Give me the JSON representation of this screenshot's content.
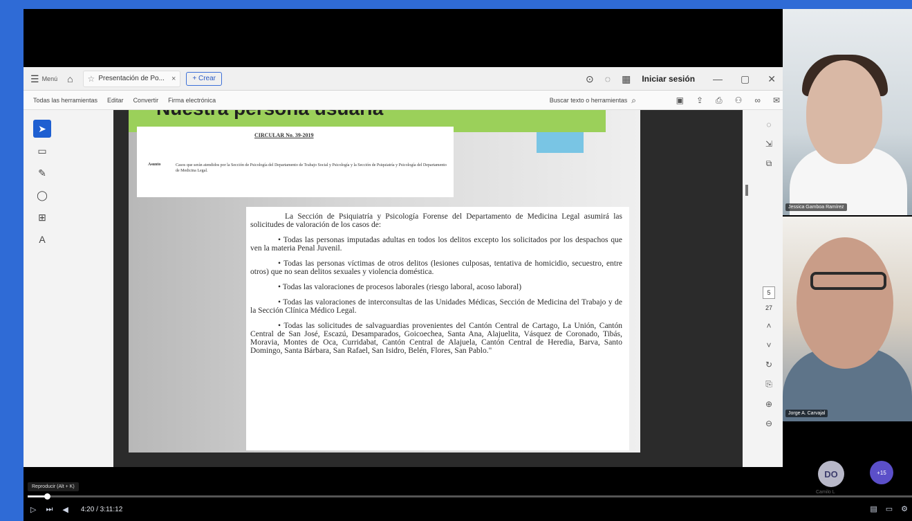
{
  "browser": {
    "menu_label": "Menú",
    "tab_title": "Presentación de Po...",
    "new_tab_label": "+ Crear",
    "signin_label": "Iniciar sesión"
  },
  "toolbar": {
    "tabs": [
      "Todas las herramientas",
      "Editar",
      "Convertir",
      "Firma electrónica"
    ],
    "search_label": "Buscar texto o herramientas"
  },
  "slide": {
    "title": "Nuestra persona usuaria",
    "circular_title": "CIRCULAR No. 39-2019",
    "asunto_label": "Asunto",
    "asunto_text": "Casos que serán atendidos por la Sección de Psicología del Departamento de Trabajo Social y Psicología y la Sección de Psiquiatría y Psicología del Departamento de Medicina Legal.",
    "paragraphs": [
      "La Sección de Psiquiatría y Psicología Forense del Departamento de Medicina Legal asumirá las solicitudes de valoración de los casos de:",
      "•        Todas las personas imputadas adultas en todos los delitos excepto los solicitados por los despachos que ven la materia Penal Juvenil.",
      "•        Todas las personas víctimas de otros delitos (lesiones culposas, tentativa de homicidio, secuestro, entre otros) que no sean delitos sexuales y violencia doméstica.",
      "•        Todas las valoraciones de procesos laborales (riesgo laboral, acoso laboral)",
      "•        Todas las valoraciones de interconsultas de las Unidades Médicas, Sección de Medicina del Trabajo y de la Sección Clínica Médico Legal.",
      "•        Todas las solicitudes de salvaguardias provenientes del Cantón Central de Cartago, La Unión, Cantón Central de San José, Escazú, Desamparados, Goicoechea, Santa Ana, Alajuelita, Vásquez de Coronado, Tibás, Moravia, Montes de Oca, Curridabat, Cantón Central de Alajuela, Cantón Central de Heredia, Barva, Santo Domingo, Santa Bárbara, San Rafael, San Isidro, Belén, Flores, San Pablo.\""
    ]
  },
  "viewer": {
    "page_current": "5",
    "page_total": "27"
  },
  "participants": [
    {
      "name": "Jessica Gamboa Ramírez"
    },
    {
      "name": "Jorge A. Carvajal"
    }
  ],
  "avatar": {
    "initials": "DO",
    "sub": "Camilo L",
    "more": "+15"
  },
  "playback": {
    "tooltip": "Reproducir (Alt + K)",
    "time": "4:20 / 3:11:12",
    "progress_fraction": 0.022
  }
}
